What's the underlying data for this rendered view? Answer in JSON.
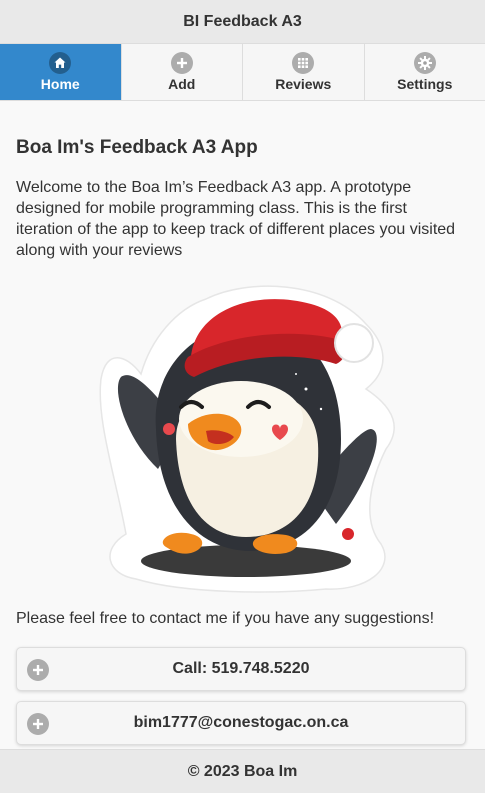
{
  "header": {
    "title": "BI Feedback A3"
  },
  "navbar": {
    "items": [
      {
        "label": "Home",
        "icon": "home-icon",
        "active": true
      },
      {
        "label": "Add",
        "icon": "plus-circle-icon",
        "active": false
      },
      {
        "label": "Reviews",
        "icon": "grid-icon",
        "active": false
      },
      {
        "label": "Settings",
        "icon": "gear-icon",
        "active": false
      }
    ]
  },
  "main": {
    "title": "Boa Im's Feedback A3 App",
    "intro": "Welcome to the Boa Im’s Feedback A3 app. A prototype designed for mobile programming class. This is the first iteration of the app to keep track of different places you visited along with your reviews",
    "contact_text": "Please feel free to contact me if you have any suggestions!",
    "buttons": [
      {
        "label": "Call: 519.748.5220",
        "icon": "plus-circle-icon"
      },
      {
        "label": "bim1777@conestogac.on.ca",
        "icon": "plus-circle-icon"
      }
    ]
  },
  "footer": {
    "text": "© 2023 Boa Im"
  },
  "colors": {
    "accent": "#3388cc",
    "bar": "#e9e9e9",
    "background": "#f9f9f9"
  }
}
